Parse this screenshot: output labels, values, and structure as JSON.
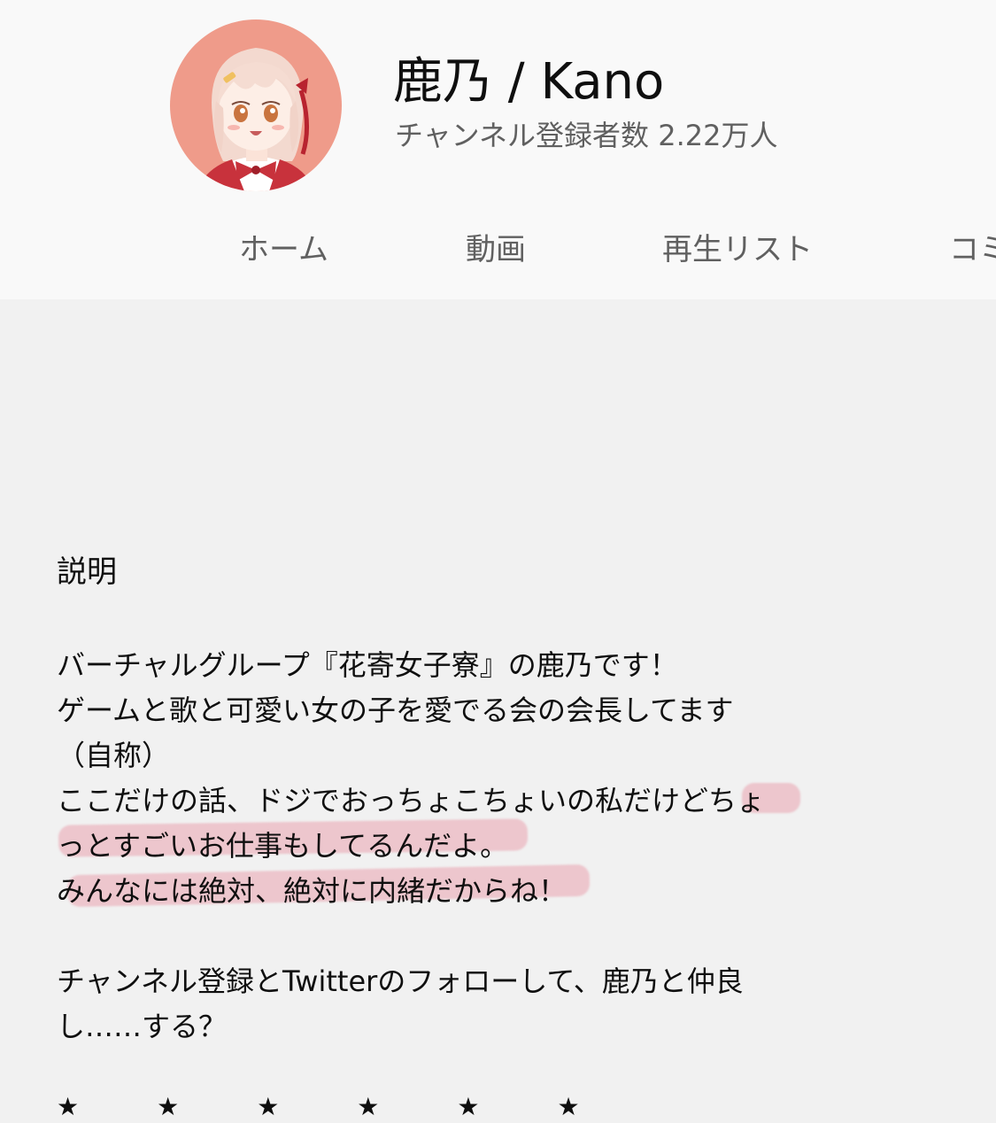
{
  "channel": {
    "name": "鹿乃 / Kano",
    "subscribers": "チャンネル登録者数 2.22万人",
    "avatar_background": "#ef9b8a"
  },
  "tabs": [
    {
      "label": "ホーム"
    },
    {
      "label": "動画"
    },
    {
      "label": "再生リスト"
    },
    {
      "label": "コミ"
    }
  ],
  "about": {
    "section_title": "説明",
    "description_lines": [
      "バーチャルグループ『花寄女子寮』の鹿乃です！",
      "ゲームと歌と可愛い女の子を愛でる会の会長してます",
      "（自称）",
      "ここだけの話、ドジでおっちょこちょいの私だけどちょ",
      "っとすごいお仕事もしてるんだよ。",
      "みんなには絶対、絶対に内緒だからね！",
      "",
      "チャンネル登録とTwitterのフォローして、鹿乃と仲良",
      "し……する？"
    ],
    "stars": "★★★★★★"
  },
  "colors": {
    "header_bg": "#f9f9f9",
    "page_bg": "#f1f1f1",
    "highlight": "#e4768a",
    "secondary_text": "#606060"
  }
}
